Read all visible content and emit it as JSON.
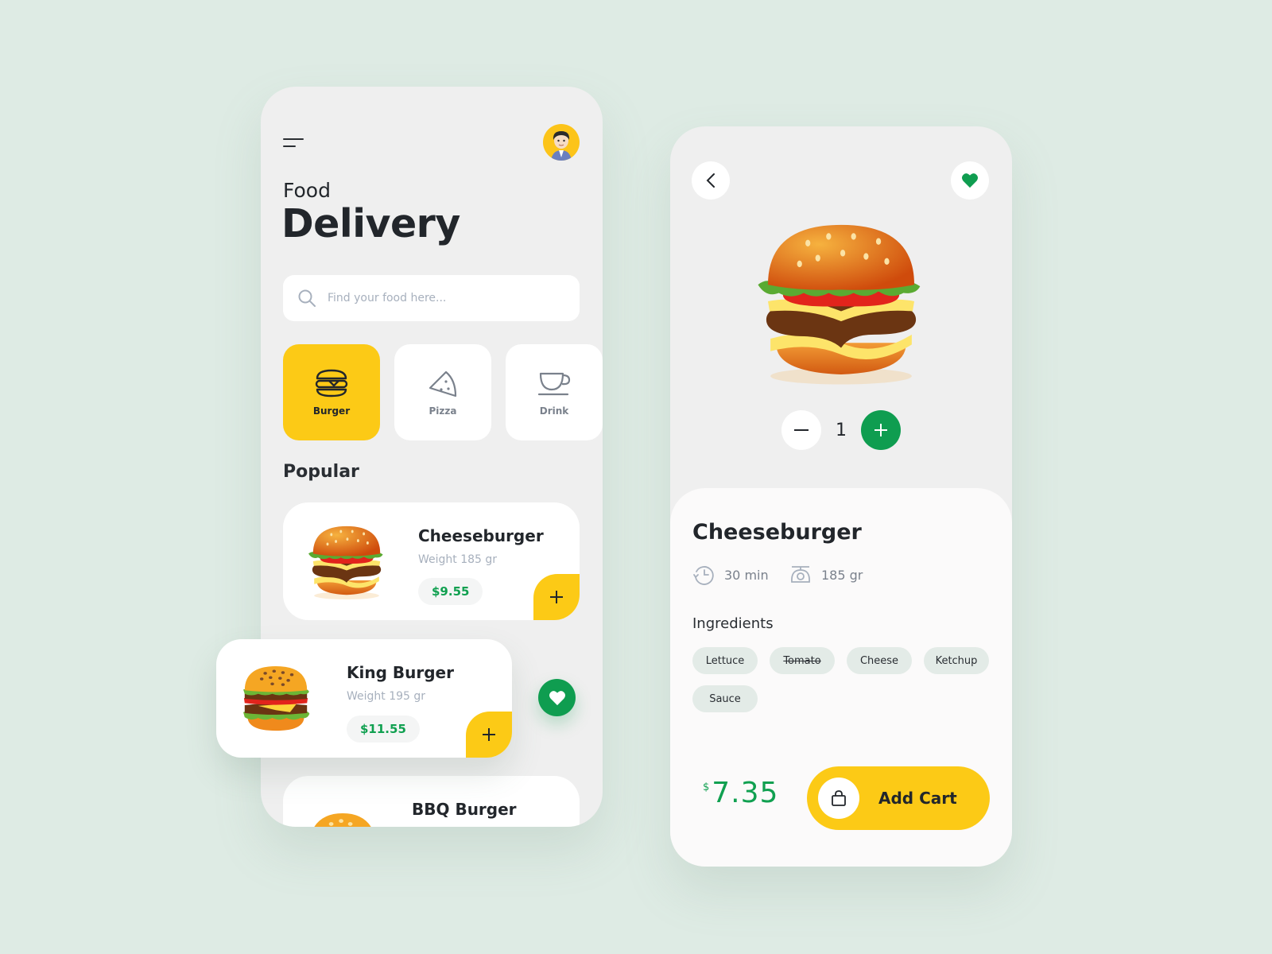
{
  "home": {
    "title_small": "Food",
    "title_big": "Delivery",
    "search": {
      "placeholder": "Find your food here...",
      "value": ""
    },
    "categories": [
      {
        "label": "Burger",
        "icon": "burger-icon",
        "active": true
      },
      {
        "label": "Pizza",
        "icon": "pizza-icon",
        "active": false
      },
      {
        "label": "Drink",
        "icon": "cup-icon",
        "active": false
      }
    ],
    "section_title": "Popular",
    "items": [
      {
        "name": "Cheeseburger",
        "weight": "Weight 185 gr",
        "price": "$9.55"
      },
      {
        "name": "King Burger",
        "weight": "Weight  195 gr",
        "price": "$11.55"
      },
      {
        "name": "BBQ Burger"
      }
    ]
  },
  "detail": {
    "quantity": "1",
    "name": "Cheeseburger",
    "time": "30 min",
    "weight": "185 gr",
    "ingredients_title": "Ingredients",
    "ingredients": [
      {
        "label": "Lettuce",
        "excluded": false
      },
      {
        "label": "Tomato",
        "excluded": true
      },
      {
        "label": "Cheese",
        "excluded": false
      },
      {
        "label": "Ketchup",
        "excluded": false
      },
      {
        "label": "Sauce",
        "excluded": false
      }
    ],
    "currency": "$",
    "total": "7.35",
    "add_cart_label": "Add Cart"
  },
  "colors": {
    "accent_yellow": "#fcca16",
    "accent_green": "#0f9d50",
    "background": "#deebe4"
  }
}
